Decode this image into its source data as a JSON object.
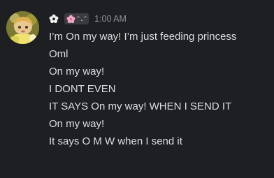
{
  "message": {
    "author_badge_text": "ᵔ.ᵔ",
    "timestamp": "1:00 AM",
    "lines": [
      "I’m On my way! I’m just feeding princess",
      "Oml",
      "On my way!",
      "I DONT EVEN",
      "IT SAYS On my way! WHEN I SEND IT",
      "On my way!",
      "It says O M W when I send it"
    ]
  },
  "colors": {
    "background": "#1e1f22",
    "text": "#dbdee1",
    "timestamp": "#8e9297",
    "badge_background": "#3a3b40",
    "badge_flower": "#f4a6c6"
  },
  "icons": {
    "header_flower": "flower-icon",
    "badge_flower": "cherry-blossom-icon",
    "avatar": "avatar"
  }
}
